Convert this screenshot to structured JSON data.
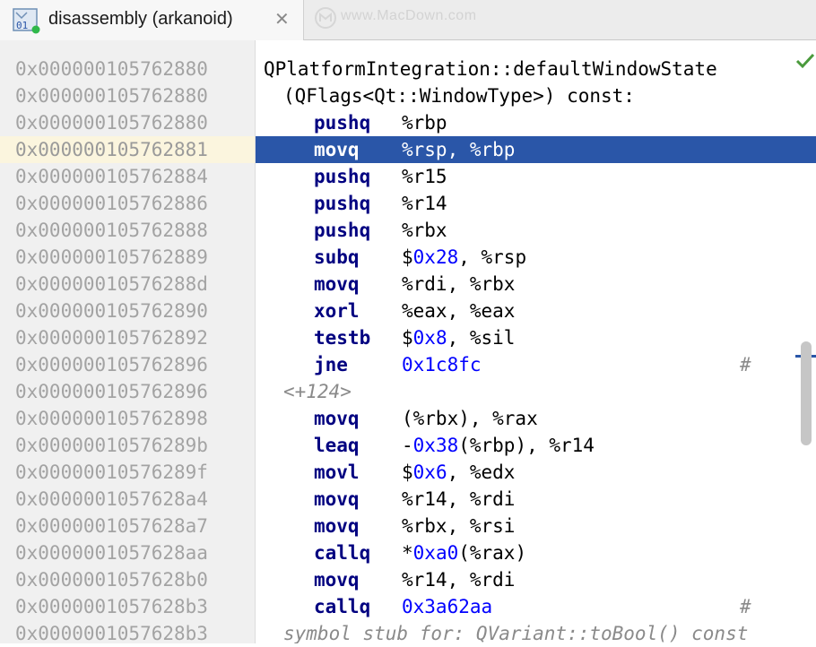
{
  "tab": {
    "title": "disassembly (arkanoid)",
    "close": "✕",
    "icon": "disassembly-file-icon",
    "watermark": "www.MacDown.com"
  },
  "gutter": {
    "addresses": [
      "0x000000105762880",
      "0x000000105762880",
      "0x000000105762880",
      "0x000000105762881",
      "0x000000105762884",
      "0x000000105762886",
      "0x000000105762888",
      "0x000000105762889",
      "0x00000010576288d",
      "0x000000105762890",
      "0x000000105762892",
      "0x000000105762896",
      "0x000000105762896",
      "0x000000105762898",
      "0x00000010576289b",
      "0x00000010576289f",
      "0x0000001057628a4",
      "0x0000001057628a7",
      "0x0000001057628aa",
      "0x0000001057628b0",
      "0x0000001057628b3",
      "0x0000001057628b3"
    ],
    "current_index": 3
  },
  "code": {
    "function_name": "QPlatformIntegration::defaultWindowState",
    "function_signature": "(QFlags<Qt::WindowType>) const:",
    "selected_index": 3,
    "rows": [
      {
        "kind": "header",
        "text": "QPlatformIntegration::defaultWindowState"
      },
      {
        "kind": "header2",
        "text": "(QFlags<Qt::WindowType>) const:"
      },
      {
        "kind": "instr",
        "mnemonic": "pushq",
        "operands": [
          [
            "%rbp",
            false
          ]
        ]
      },
      {
        "kind": "instr",
        "mnemonic": "movq",
        "operands": [
          [
            "%rsp, %rbp",
            false
          ]
        ]
      },
      {
        "kind": "instr",
        "mnemonic": "pushq",
        "operands": [
          [
            "%r15",
            false
          ]
        ]
      },
      {
        "kind": "instr",
        "mnemonic": "pushq",
        "operands": [
          [
            "%r14",
            false
          ]
        ]
      },
      {
        "kind": "instr",
        "mnemonic": "pushq",
        "operands": [
          [
            "%rbx",
            false
          ]
        ]
      },
      {
        "kind": "instr",
        "mnemonic": "subq",
        "operands": [
          [
            "$",
            false
          ],
          [
            "0x28",
            true
          ],
          [
            ", %rsp",
            false
          ]
        ]
      },
      {
        "kind": "instr",
        "mnemonic": "movq",
        "operands": [
          [
            "%rdi, %rbx",
            false
          ]
        ]
      },
      {
        "kind": "instr",
        "mnemonic": "xorl",
        "operands": [
          [
            "%eax, %eax",
            false
          ]
        ]
      },
      {
        "kind": "instr",
        "mnemonic": "testb",
        "operands": [
          [
            "$",
            false
          ],
          [
            "0x8",
            true
          ],
          [
            ", %sil",
            false
          ]
        ]
      },
      {
        "kind": "instr",
        "mnemonic": "jne",
        "operands": [
          [
            "0x1c8fc",
            true
          ]
        ],
        "comment": "#"
      },
      {
        "kind": "label",
        "text": "<+124>"
      },
      {
        "kind": "instr",
        "mnemonic": "movq",
        "operands": [
          [
            "(%rbx), %rax",
            false
          ]
        ]
      },
      {
        "kind": "instr",
        "mnemonic": "leaq",
        "operands": [
          [
            "-",
            false
          ],
          [
            "0x38",
            true
          ],
          [
            "(%rbp), %r14",
            false
          ]
        ]
      },
      {
        "kind": "instr",
        "mnemonic": "movl",
        "operands": [
          [
            "$",
            false
          ],
          [
            "0x6",
            true
          ],
          [
            ", %edx",
            false
          ]
        ]
      },
      {
        "kind": "instr",
        "mnemonic": "movq",
        "operands": [
          [
            "%r14, %rdi",
            false
          ]
        ]
      },
      {
        "kind": "instr",
        "mnemonic": "movq",
        "operands": [
          [
            "%rbx, %rsi",
            false
          ]
        ]
      },
      {
        "kind": "instr",
        "mnemonic": "callq",
        "operands": [
          [
            "*",
            false
          ],
          [
            "0xa0",
            true
          ],
          [
            "(%rax)",
            false
          ]
        ]
      },
      {
        "kind": "instr",
        "mnemonic": "movq",
        "operands": [
          [
            "%r14, %rdi",
            false
          ]
        ]
      },
      {
        "kind": "instr",
        "mnemonic": "callq",
        "operands": [
          [
            "0x3a62aa",
            true
          ]
        ],
        "comment": "#"
      },
      {
        "kind": "note",
        "text": "symbol stub for: QVariant::toBool() const"
      }
    ]
  },
  "status": {
    "inspection_icon": "checkmark-icon",
    "inspection_color": "#4a9a3c"
  },
  "colors": {
    "mnemonic": "#000080",
    "number": "#0000ff",
    "selection": "#2a56a8",
    "current_line": "#fbf5de",
    "comment": "#8a8a8a"
  }
}
